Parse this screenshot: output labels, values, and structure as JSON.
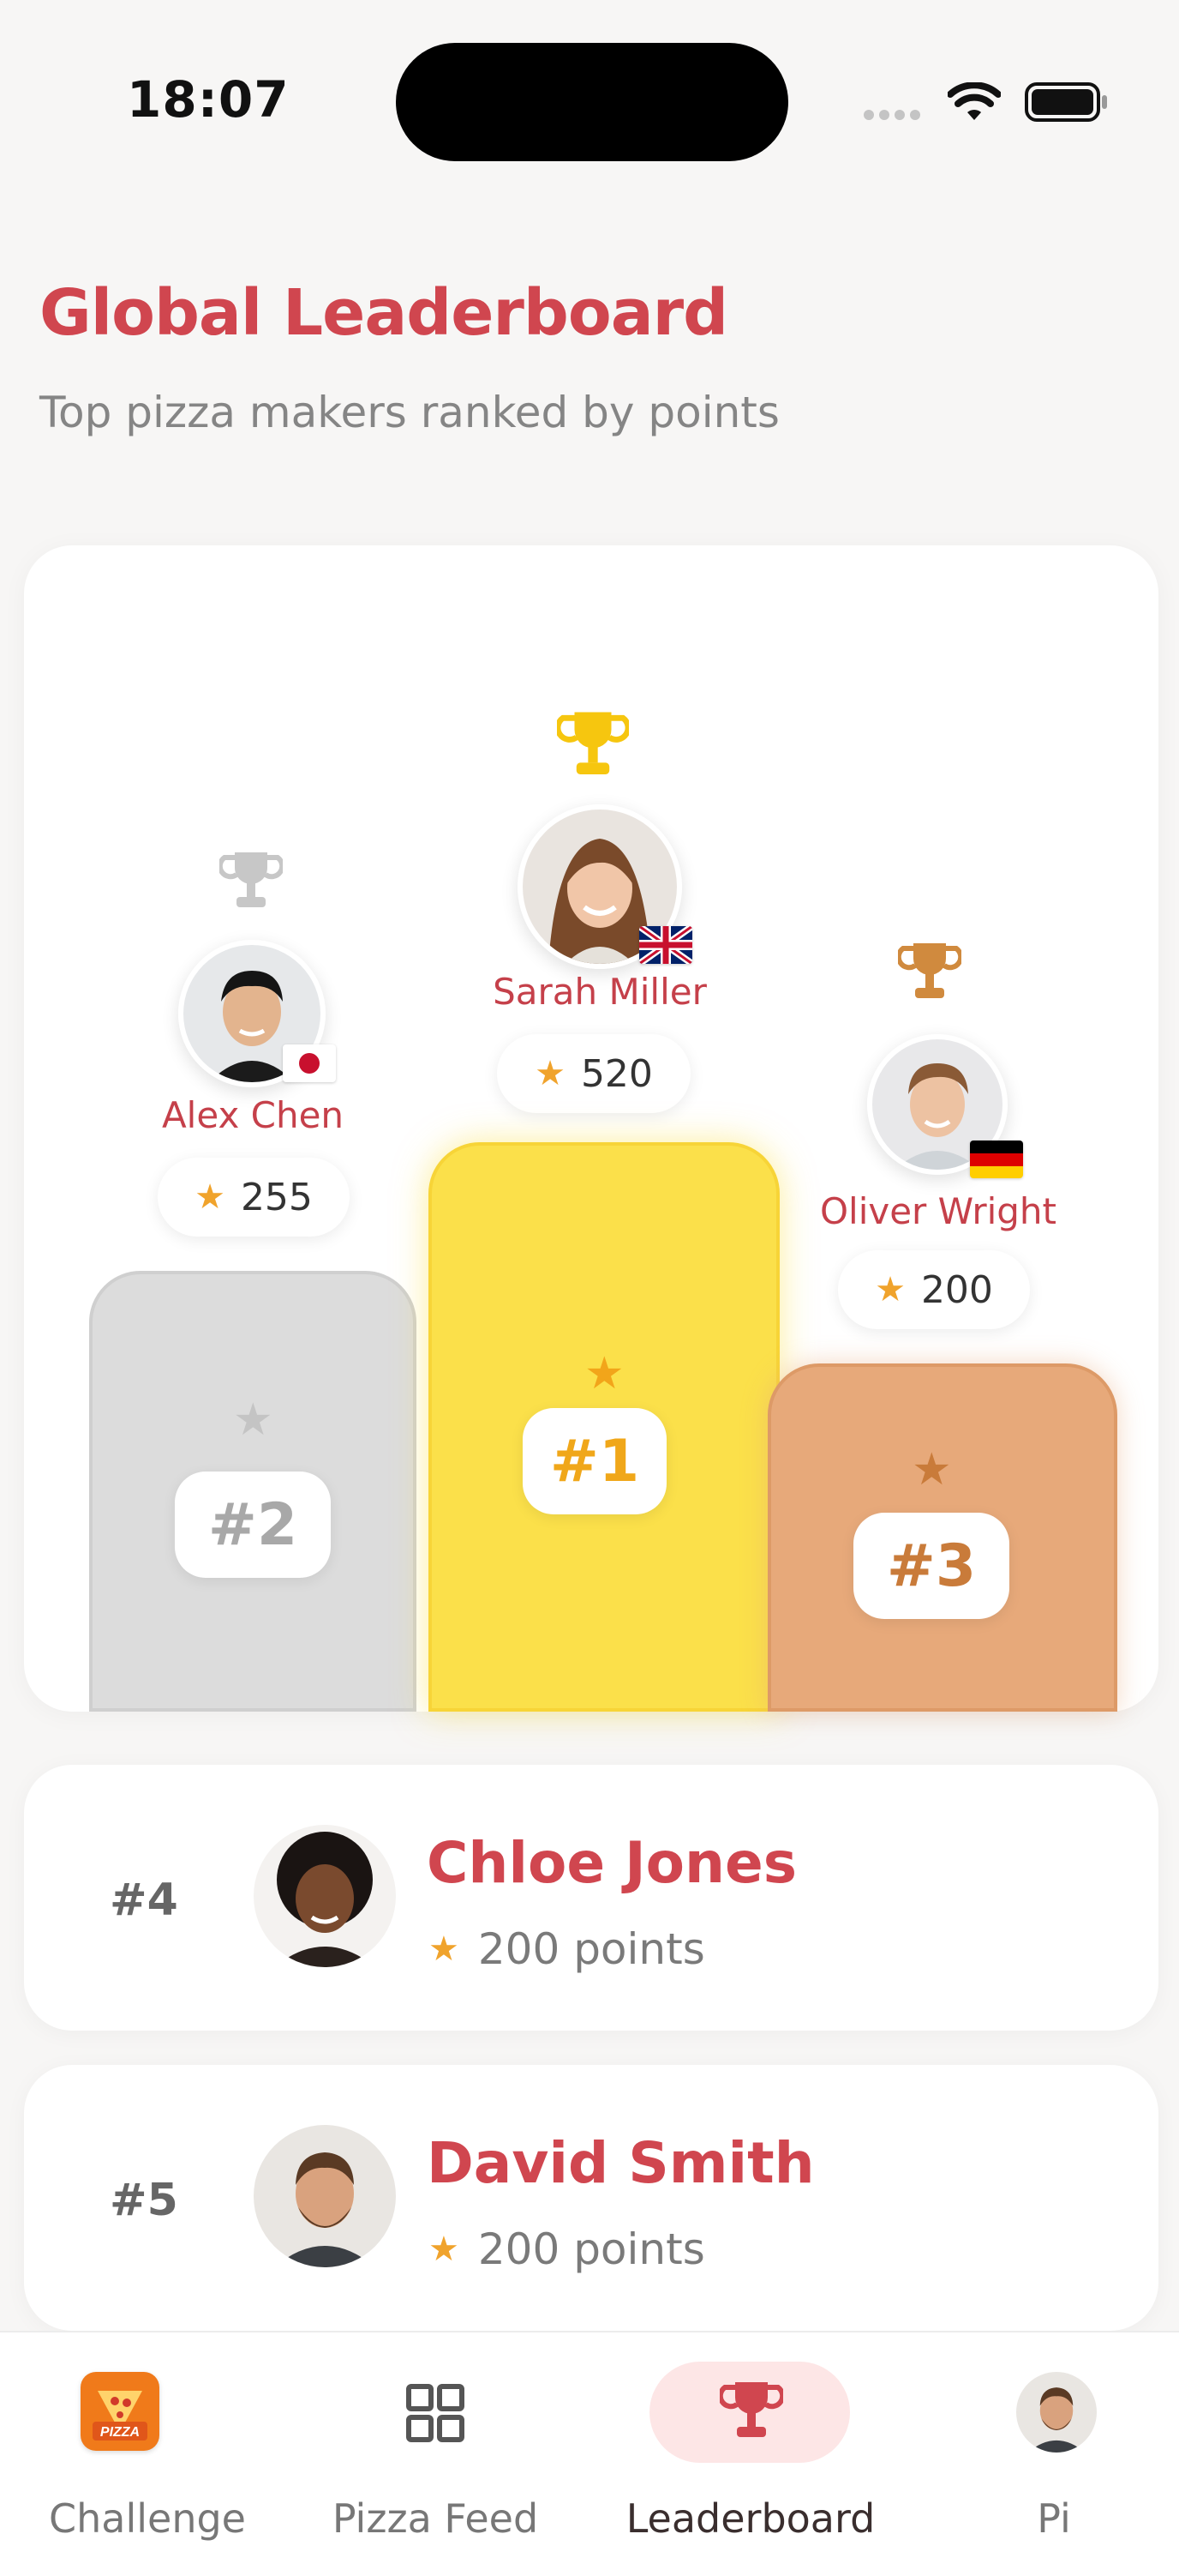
{
  "status_bar": {
    "time": "18:07"
  },
  "header": {
    "title": "Global Leaderboard",
    "subtitle": "Top pizza makers ranked by points"
  },
  "podium": {
    "first": {
      "name": "Sarah Miller",
      "points": "520",
      "rank": "#1",
      "country_flag": "united-kingdom",
      "trophy": "gold"
    },
    "second": {
      "name": "Alex Chen",
      "points": "255",
      "rank": "#2",
      "country_flag": "japan",
      "trophy": "silver"
    },
    "third": {
      "name": "Oliver Wright",
      "points": "200",
      "rank": "#3",
      "country_flag": "germany",
      "trophy": "bronze"
    }
  },
  "rankings": [
    {
      "rank": "#4",
      "name": "Chloe Jones",
      "points": "200 points"
    },
    {
      "rank": "#5",
      "name": "David Smith",
      "points": "200 points"
    }
  ],
  "tabs": [
    {
      "label": "Challenge",
      "icon": "pizza-badge-icon",
      "active": false
    },
    {
      "label": "Pizza Feed",
      "icon": "grid-icon",
      "active": false
    },
    {
      "label": "Leaderboard",
      "icon": "trophy-icon",
      "active": true
    },
    {
      "label": "Pi",
      "icon": "profile-avatar",
      "active": false
    }
  ],
  "colors": {
    "accent": "#d0464f",
    "gold": "#fbe04a",
    "silver": "#dcdcdc",
    "bronze": "#e7a97a",
    "star": "#f0a32c"
  }
}
